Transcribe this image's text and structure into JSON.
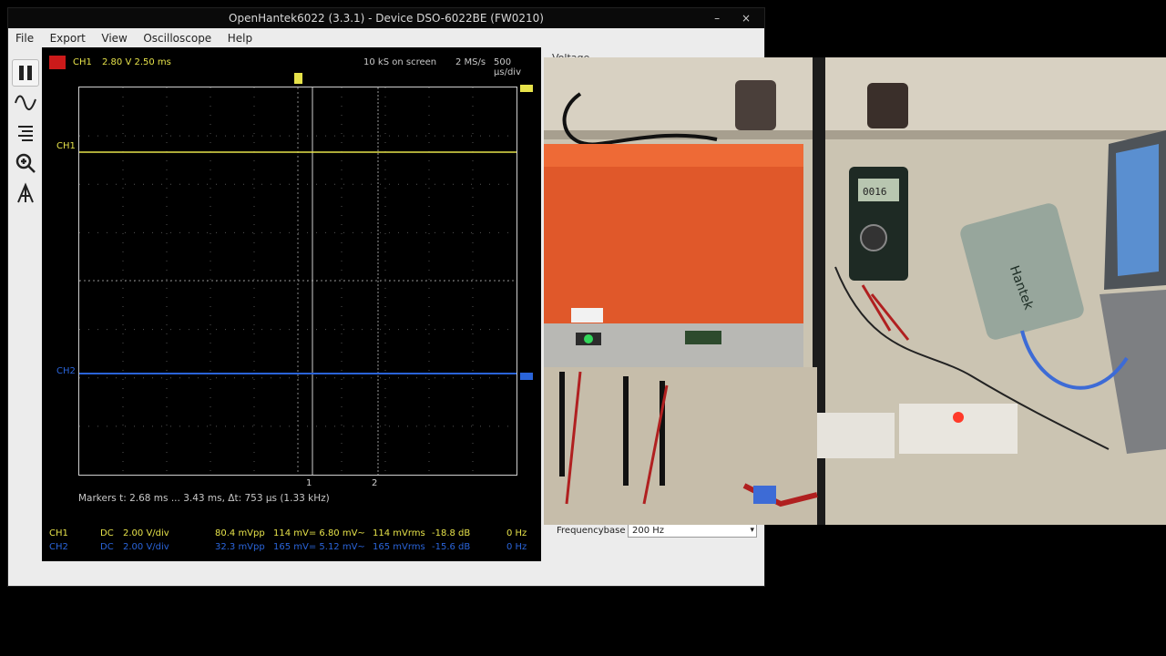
{
  "window": {
    "title": "OpenHantek6022 (3.3.1) - Device DSO-6022BE (FW0210)",
    "minimize": "–",
    "close": "×"
  },
  "menu": [
    "File",
    "Export",
    "View",
    "Oscilloscope",
    "Help"
  ],
  "toolbar": {
    "tools": [
      "pause-icon",
      "waveform-icon",
      "levels-icon",
      "zoom-icon",
      "cursor-icon"
    ]
  },
  "scope": {
    "channel": "CH1",
    "trigger": "2.80 V  2.50 ms",
    "samples": "10 kS on screen",
    "rate": "2 MS/s",
    "timebase": "500 µs/div",
    "ch1_tag": "CH1",
    "ch2_tag": "CH2",
    "marker1_label": "1",
    "marker2_label": "2",
    "markers_info": "Markers   t: 2.68 ms ... 3.43 ms,  Δt: 753 µs (1.33 kHz)",
    "ch1_color": "#e6e24a",
    "ch2_color": "#2a64d9",
    "trigger_color": "#cc1a1a"
  },
  "measurements": [
    {
      "channel": "CH1",
      "coupling": "DC",
      "vdiv": "2.00 V/div",
      "vpp": "80.4 mVpp",
      "mean": "114 mV= 6.80 mV~",
      "rms": "114 mVrms",
      "db": "-18.8 dB",
      "freq": "0 Hz"
    },
    {
      "channel": "CH2",
      "coupling": "DC",
      "vdiv": "2.00 V/div",
      "vpp": "32.3 mVpp",
      "mean": "165 mV= 5.12 mV~",
      "rms": "165 mVrms",
      "db": "-15.6 dB",
      "freq": "0 Hz"
    }
  ],
  "side_panel": {
    "voltage_label": "Voltage",
    "frequencybase_label": "Frequencybase",
    "frequencybase_value": "200 Hz"
  },
  "camera": {
    "meter_display": "0016",
    "device_brand": "Hantek"
  }
}
